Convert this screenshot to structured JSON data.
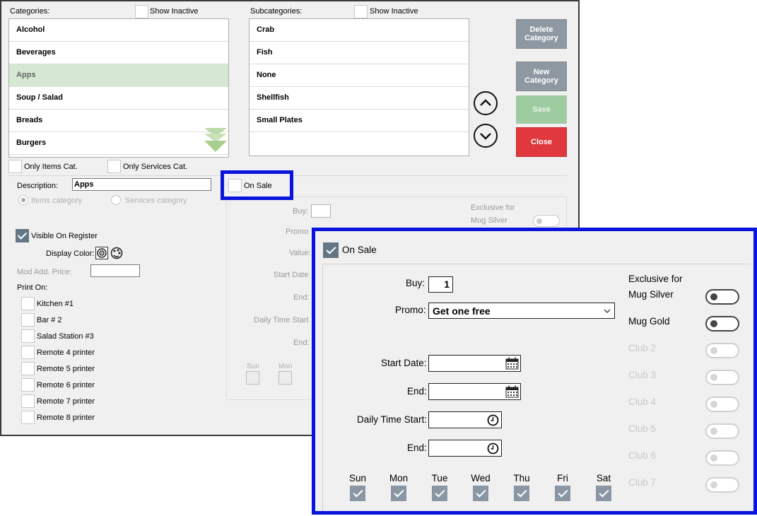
{
  "categories": {
    "label": "Categories:",
    "show_inactive": "Show Inactive",
    "items": [
      "Alcohol",
      "Beverages",
      "Apps",
      "Soup / Salad",
      "Breads",
      "Burgers"
    ],
    "selected": "Apps"
  },
  "subcategories": {
    "label": "Subcategories:",
    "show_inactive": "Show Inactive",
    "items": [
      "Crab",
      "Fish",
      "None",
      "Shellfish",
      "Small Plates"
    ]
  },
  "buttons": {
    "delete_category": "Delete Category",
    "new_category": "New Category",
    "save": "Save",
    "close": "Close"
  },
  "filters": {
    "only_items": "Only Items Cat.",
    "only_services": "Only Services Cat."
  },
  "details": {
    "description_label": "Description:",
    "description_value": "Apps",
    "items_category": "Items category",
    "services_category": "Services category",
    "visible_on_register": "Visible On Register",
    "display_color": "Display Color:",
    "mod_add_price": "Mod Add. Price:",
    "print_on": "Print On:",
    "printers": [
      "Kitchen #1",
      "Bar # 2",
      "Salad Station #3",
      "Remote 4 printer",
      "Remote 5 printer",
      "Remote 6 printer",
      "Remote 7 printer",
      "Remote 8 printer"
    ]
  },
  "on_sale_bg": {
    "label": "On Sale",
    "buy": "Buy:",
    "promo": "Promo",
    "value": "Value:",
    "start_date": "Start Date",
    "end": "End:",
    "daily_time_start": "Daily Time Start",
    "end2": "End:",
    "exclusive_for": "Exclusive for",
    "mug_silver": "Mug Silver",
    "sun": "Sun",
    "mon": "Mon"
  },
  "popup": {
    "on_sale": "On Sale",
    "buy_label": "Buy:",
    "buy_value": "1",
    "promo_label": "Promo:",
    "promo_value": "Get one free",
    "start_date_label": "Start Date:",
    "end_label": "End:",
    "daily_time_start_label": "Daily Time Start:",
    "end2_label": "End:",
    "exclusive_for": "Exclusive for",
    "memberships": [
      "Mug Silver",
      "Mug Gold",
      "Club 2",
      "Club 3",
      "Club 4",
      "Club 5",
      "Club 6",
      "Club 7"
    ],
    "days": [
      "Sun",
      "Mon",
      "Tue",
      "Wed",
      "Thu",
      "Fri",
      "Sat"
    ]
  },
  "colors": {
    "highlight_border": "#0a14dc",
    "selected_row": "#d5e8d2",
    "close_button": "#e0383d",
    "save_button": "#9ccca0",
    "checkbox_checked": "#647685"
  }
}
